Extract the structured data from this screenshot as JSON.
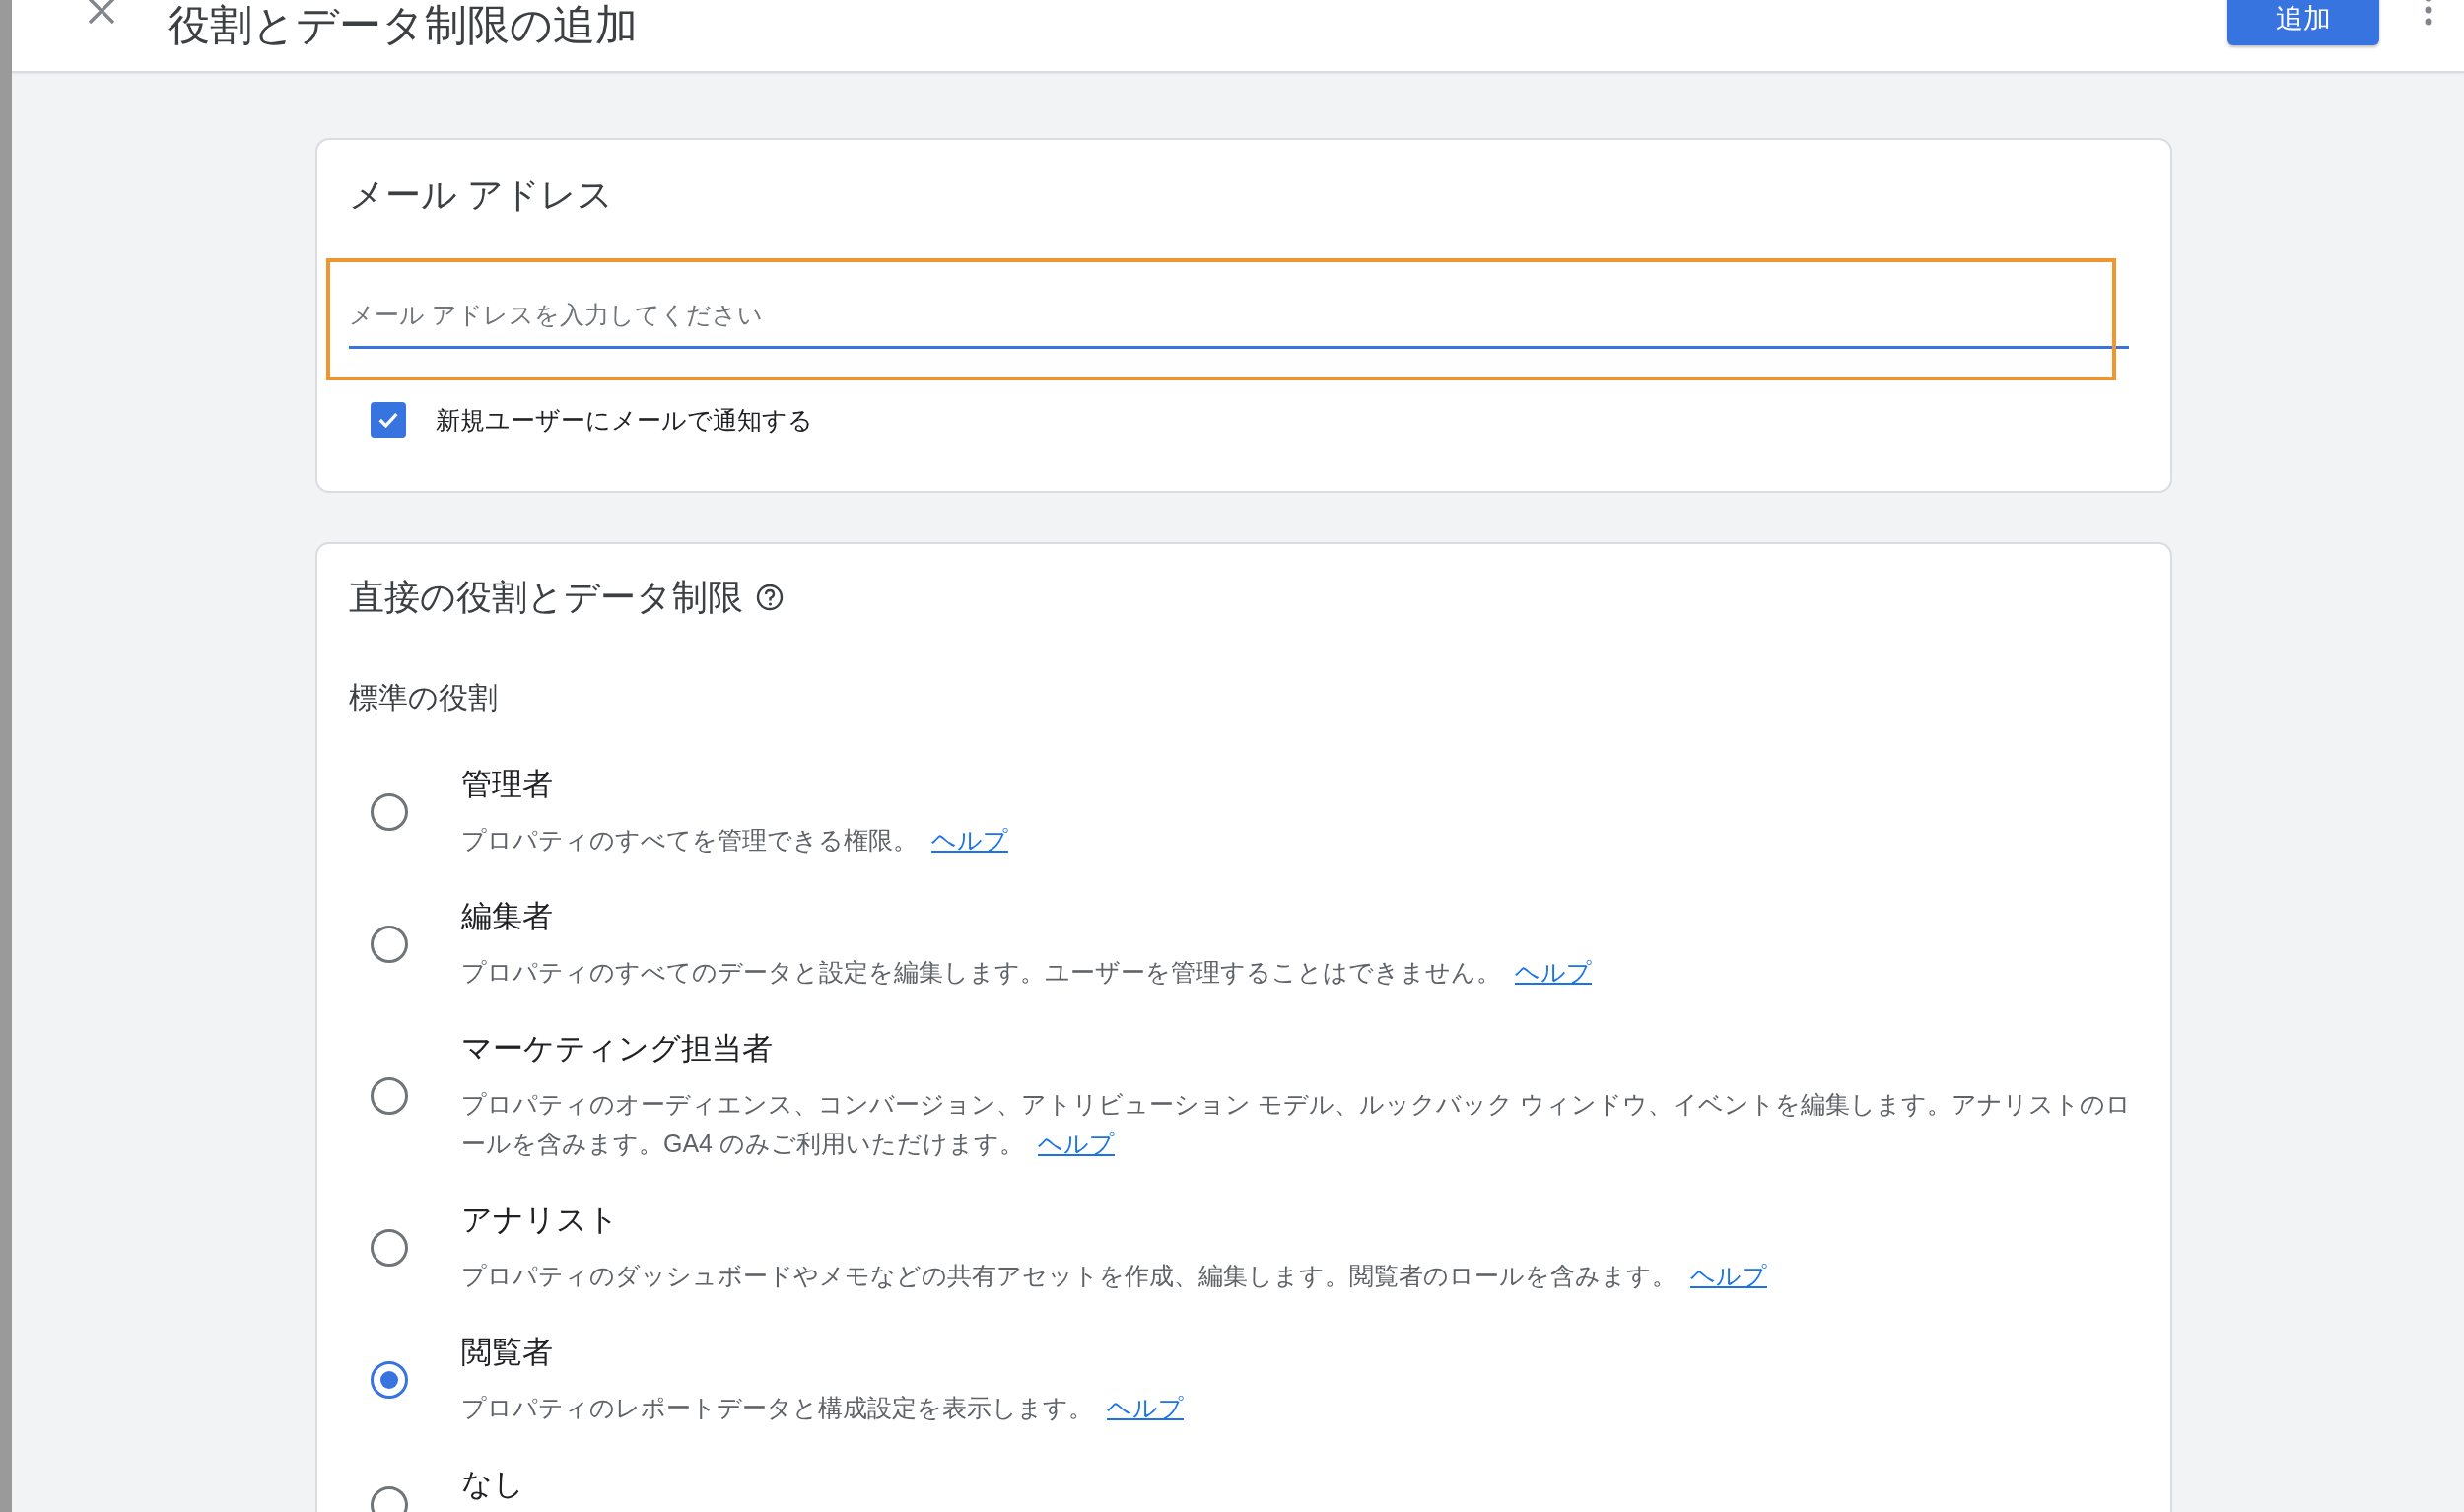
{
  "header": {
    "title": "役割とデータ制限の追加",
    "add_button": "追加"
  },
  "email_card": {
    "title": "メール アドレス",
    "field": {
      "placeholder": "メール アドレスを入力してください",
      "highlighted": true
    },
    "notify": {
      "label": "新規ユーザーにメールで通知する",
      "checked": true
    }
  },
  "roles_card": {
    "title": "直接の役割とデータ制限",
    "section": "標準の役割",
    "roles": [
      {
        "name": "管理者",
        "description": "プロパティのすべてを管理できる権限。",
        "link": "ヘルプ",
        "selected": false
      },
      {
        "name": "編集者",
        "description": "プロパティのすべてのデータと設定を編集します。ユーザーを管理することはできません。",
        "link": "ヘルプ",
        "selected": false
      },
      {
        "name": "マーケティング担当者",
        "description": "プロパティのオーディエンス、コンバージョン、アトリビューション モデル、ルックバック ウィンドウ、イベントを編集します。アナリストのロールを含みます。GA4 のみご利用いただけます。",
        "link": "ヘルプ",
        "selected": false
      },
      {
        "name": "アナリスト",
        "description": "プロパティのダッシュボードやメモなどの共有アセットを作成、編集します。閲覧者のロールを含みます。",
        "link": "ヘルプ",
        "selected": false
      },
      {
        "name": "閲覧者",
        "description": "プロパティのレポートデータと構成設定を表示します。",
        "link": "ヘルプ",
        "selected": true
      },
      {
        "name": "なし",
        "selected": false
      }
    ]
  }
}
